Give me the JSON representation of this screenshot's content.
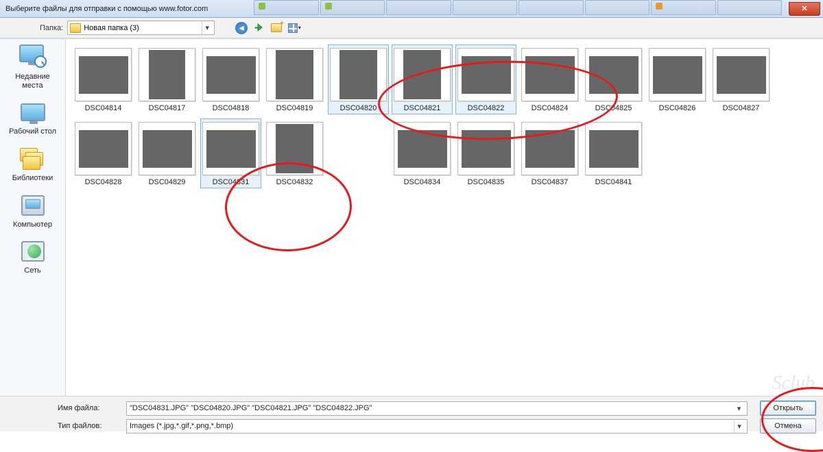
{
  "window": {
    "title": "Выберите файлы для отправки с помощью www.fotor.com"
  },
  "toolbar": {
    "folder_label": "Папка:",
    "folder_name": "Новая папка (3)"
  },
  "places": {
    "recent": "Недавние места",
    "desktop": "Рабочий стол",
    "libraries": "Библиотеки",
    "computer": "Компьютер",
    "network": "Сеть"
  },
  "files_row1": [
    {
      "name": "DSC04814",
      "shape": "a1",
      "sel": false
    },
    {
      "name": "DSC04817",
      "shape": "a2",
      "sel": false
    },
    {
      "name": "DSC04818",
      "shape": "a3",
      "sel": false
    },
    {
      "name": "DSC04819",
      "shape": "a4",
      "sel": false
    },
    {
      "name": "DSC04820",
      "shape": "a5",
      "sel": true
    },
    {
      "name": "DSC04821",
      "shape": "a6",
      "sel": true
    },
    {
      "name": "DSC04822",
      "shape": "a7",
      "sel": true
    },
    {
      "name": "DSC04824",
      "shape": "a8",
      "sel": false
    },
    {
      "name": "DSC04825",
      "shape": "a9",
      "sel": false
    },
    {
      "name": "DSC04826",
      "shape": "a10",
      "sel": false
    },
    {
      "name": "DSC04827",
      "shape": "a11",
      "sel": false
    }
  ],
  "files_row2": [
    {
      "name": "DSC04828",
      "shape": "b1",
      "sel": false
    },
    {
      "name": "DSC04829",
      "shape": "b2",
      "sel": false
    },
    {
      "name": "DSC04831",
      "shape": "b3",
      "sel": true
    },
    {
      "name": "DSC04832",
      "shape": "b4",
      "sel": false
    },
    {
      "name": "DSC04834",
      "shape": "b5",
      "sel": false
    },
    {
      "name": "DSC04835",
      "shape": "b6",
      "sel": false
    },
    {
      "name": "DSC04837",
      "shape": "b7",
      "sel": false
    },
    {
      "name": "DSC04841",
      "shape": "b8",
      "sel": false
    }
  ],
  "bottom": {
    "filename_label": "Имя файла:",
    "filename_value": "\"DSC04831.JPG\" \"DSC04820.JPG\" \"DSC04821.JPG\" \"DSC04822.JPG\"",
    "filetype_label": "Тип файлов:",
    "filetype_value": "Images (*.jpg,*.gif,*.png,*.bmp)",
    "open": "Открыть",
    "cancel": "Отмена"
  },
  "watermark": "Sclub"
}
